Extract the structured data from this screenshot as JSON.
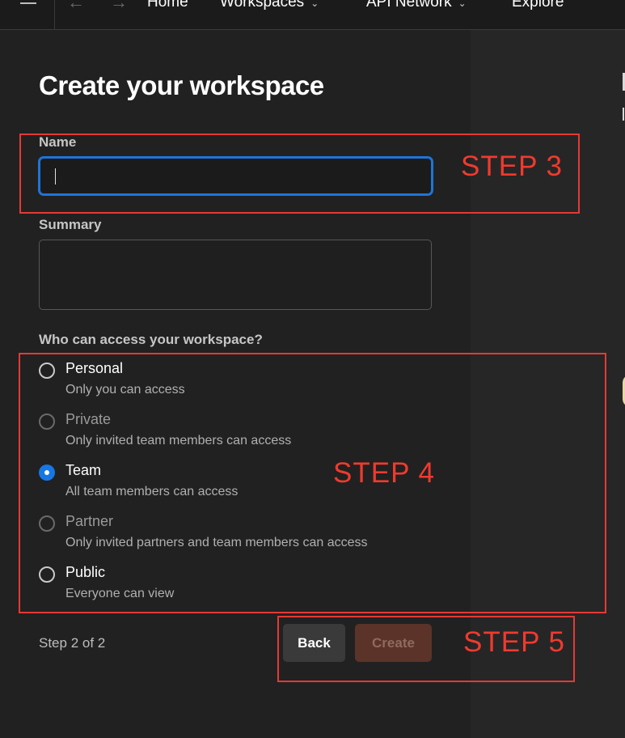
{
  "nav": {
    "items": [
      {
        "label": "Home"
      },
      {
        "label": "Workspaces"
      },
      {
        "label": "API Network"
      },
      {
        "label": "Explore"
      }
    ]
  },
  "form": {
    "title": "Create your workspace",
    "name_label": "Name",
    "name_value": "",
    "summary_label": "Summary",
    "summary_value": "",
    "access_label": "Who can access your workspace?",
    "options": [
      {
        "title": "Personal",
        "desc": "Only you can access",
        "state": "enabled"
      },
      {
        "title": "Private",
        "desc": "Only invited team members can access",
        "state": "disabled"
      },
      {
        "title": "Team",
        "desc": "All team members can access",
        "state": "selected"
      },
      {
        "title": "Partner",
        "desc": "Only invited partners and team members can access",
        "state": "disabled"
      },
      {
        "title": "Public",
        "desc": "Everyone can view",
        "state": "enabled"
      }
    ],
    "step_text": "Step 2 of 2",
    "back_label": "Back",
    "create_label": "Create"
  },
  "annotations": {
    "step3": "STEP 3",
    "step4": "STEP 4",
    "step5": "STEP 5"
  },
  "colors": {
    "accent": "#1e74d8",
    "annotation": "#e53935",
    "create_disabled": "#5b3328"
  }
}
